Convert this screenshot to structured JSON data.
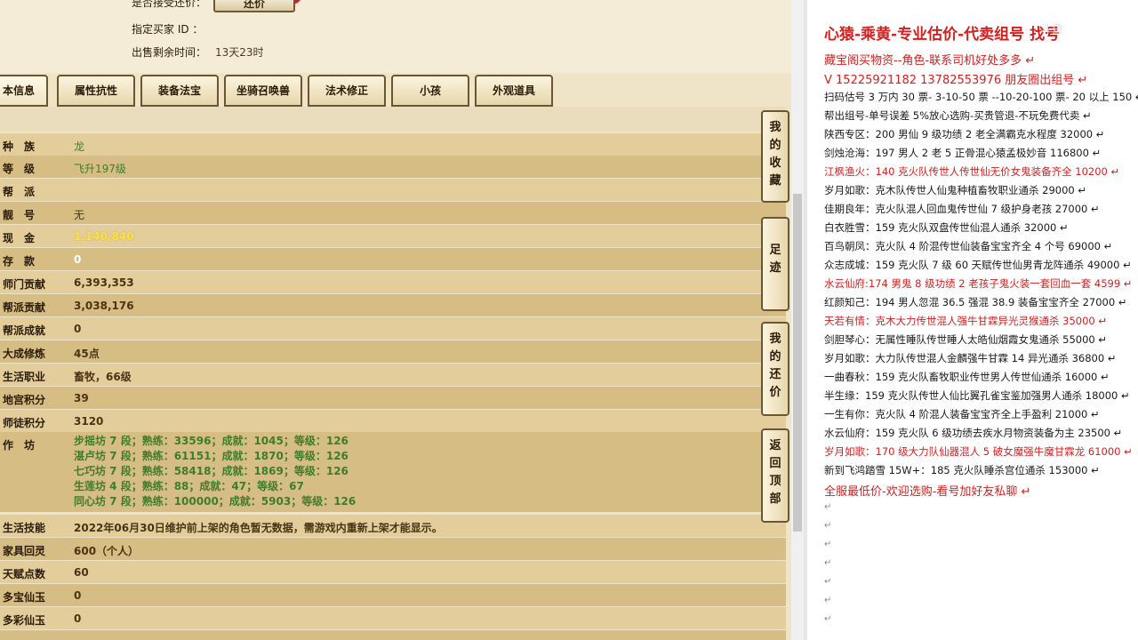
{
  "top_fields": {
    "accept_offer_label": "是否接受还价：",
    "offer_button": "还价",
    "buyer_id_label": "指定买家 ID ：",
    "time_left_label": "出售剩余时间：",
    "time_left_value": "13天23时"
  },
  "tabs": [
    {
      "label": "本信息"
    },
    {
      "label": "属性抗性"
    },
    {
      "label": "装备法宝"
    },
    {
      "label": "坐骑召唤兽"
    },
    {
      "label": "法术修正"
    },
    {
      "label": "小孩"
    },
    {
      "label": "外观道具"
    }
  ],
  "rows": [
    {
      "label": "种　族",
      "value": "龙"
    },
    {
      "label": "等　级",
      "value": "飞升197级"
    },
    {
      "label": "帮　派",
      "value": ""
    },
    {
      "label": "靓　号",
      "value": "无"
    },
    {
      "label": "现　金",
      "value": "1,140,840"
    },
    {
      "label": "存　款",
      "value": "0"
    },
    {
      "label": "师门贡献",
      "value": "6,393,353"
    },
    {
      "label": "帮派贡献",
      "value": "3,038,176"
    },
    {
      "label": "帮派成就",
      "value": "0"
    },
    {
      "label": "大成修炼",
      "value": "45点"
    },
    {
      "label": "生活职业",
      "value": "畜牧，66级"
    },
    {
      "label": "地宫积分",
      "value": "39"
    },
    {
      "label": "师徒积分",
      "value": "3120"
    }
  ],
  "workshop": {
    "label": "作　坊",
    "lines": [
      "步摇坊 7 段；熟练：33596；成就：1045；等级：126",
      "湛卢坊 7 段；熟练：61151；成就：1870；等级：126",
      "七巧坊 7 段；熟练：58418；成就：1869；等级：126",
      "生莲坊 4 段；熟练：88；成就：47；等级：67",
      "同心坊 7 段；熟练：100000；成就：5903；等级：126"
    ]
  },
  "rows2": [
    {
      "label": "生活技能",
      "value": "2022年06月30日维护前上架的角色暂无数据，需游戏内重新上架才能显示。"
    },
    {
      "label": "家具回灵",
      "value": "600（个人）"
    },
    {
      "label": "天赋点数",
      "value": "60"
    },
    {
      "label": "多宝仙玉",
      "value": "0"
    },
    {
      "label": "多彩仙玉",
      "value": "0"
    }
  ],
  "side_buttons": [
    {
      "label": "我的收藏",
      "chars": [
        "我",
        "的",
        "收",
        "藏"
      ]
    },
    {
      "label": "足迹",
      "chars": [
        "足",
        "迹"
      ]
    },
    {
      "label": "我的还价",
      "chars": [
        "我",
        "的",
        "还",
        "价"
      ]
    },
    {
      "label": "返回顶部",
      "chars": [
        "返",
        "回",
        "顶",
        "部"
      ]
    }
  ],
  "doc": {
    "title": "心猿-乘黄-专业估价-代卖组号 找号",
    "watermark": "斗鱼",
    "lines": [
      {
        "text": "藏宝阁买物资--角色-联系司机好处多多",
        "style": "red big"
      },
      {
        "text": "V 15225921182   13782553976 朋友圈出组号",
        "style": "red big"
      },
      {
        "text": "扫码估号 3 万内 30 票- 3-10-50 票  --10-20-100 票- 20 以上 150",
        "style": ""
      },
      {
        "text": "帮出组号-单号误差 5%放心选购-买贵管退-不玩免费代卖",
        "style": ""
      },
      {
        "text": "陕西专区：200 男仙 9 级功绩 2 老全满霸克水程度 32000",
        "style": ""
      },
      {
        "text": "剑烛沧海：197 男人 2 老 5 正骨混心猿孟极妙音 116800",
        "style": ""
      },
      {
        "text": "江枫渔火：140 克火队传世人传世仙无价女鬼装备齐全 10200",
        "style": "red"
      },
      {
        "text": "岁月如歌：克木队传世人仙鬼种植畜牧职业通杀 29000",
        "style": ""
      },
      {
        "text": "佳期良年：克火队混人回血鬼传世仙 7 级护身老孩 27000",
        "style": ""
      },
      {
        "text": "白衣胜雪：159 克火队双盘传世仙混人通杀 32000",
        "style": ""
      },
      {
        "text": "百鸟朝凤：克火队 4 阶混传世仙装备宝宝齐全 4 个号 69000",
        "style": ""
      },
      {
        "text": "众志成城：159 克火队 7 级 60 天赋传世仙男青龙阵通杀 49000",
        "style": ""
      },
      {
        "text": "水云仙府:174 男鬼 8 级功绩 2 老孩子鬼火装一套回血一套 4599",
        "style": "red"
      },
      {
        "text": "红颜知己：194 男人忽混 36.5 强混 38.9 装备宝宝齐全 27000",
        "style": ""
      },
      {
        "text": "天若有情：克木大力传世混人强牛甘霖异光灵猴通杀 35000",
        "style": "red"
      },
      {
        "text": "剑胆琴心：无属性睡队传世睡人太皓仙烟霞女鬼通杀 55000",
        "style": ""
      },
      {
        "text": "岁月如歌：大力队传世混人金麟强牛甘霖 14 异光通杀 36800",
        "style": ""
      },
      {
        "text": "一曲春秋：159 克火队畜牧职业传世男人传世仙通杀 16000",
        "style": ""
      },
      {
        "text": "半生缘：159 克火队传世人仙比翼孔雀宝鉴加强男人通杀 18000",
        "style": ""
      },
      {
        "text": "一生有你：克火队 4 阶混人装备宝宝齐全上手盈利 21000",
        "style": ""
      },
      {
        "text": "水云仙府：159 克火队 6 级功绩去疾水月物资装备为主 23500",
        "style": ""
      },
      {
        "text": "岁月如歌：170 级大力队仙器混人 5 破女魔强牛魔甘霖龙 61000",
        "style": "red"
      },
      {
        "text": "新到飞鸿踏雪 15W+：185 克火队睡杀宫位通杀 153000",
        "style": ""
      },
      {
        "text": "全服最低价-欢迎选购-看号加好友私聊",
        "style": "red big"
      }
    ],
    "paragraph_mark": "↵"
  },
  "colors": {
    "red": "#d42020",
    "panel_bg": "#efe4c8",
    "row_a": "#e2cd9b",
    "row_b": "#d6bd83"
  }
}
